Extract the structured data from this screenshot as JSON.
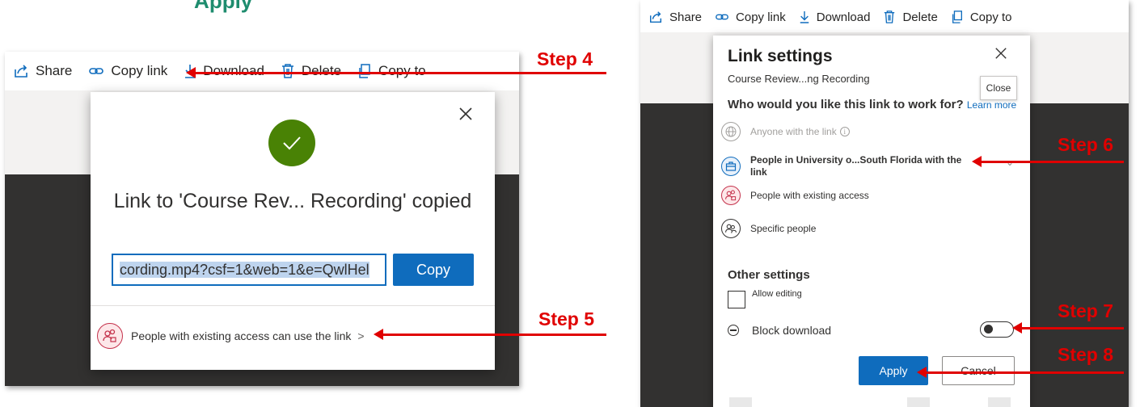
{
  "top_fragment": "’ Apply",
  "left": {
    "toolbar": {
      "share": "Share",
      "copy_link": "Copy link",
      "download": "Download",
      "delete": "Delete",
      "copy_to": "Copy to"
    },
    "dialog": {
      "title": "Link to 'Course Rev... Recording' copied",
      "link_value": "cording.mp4?csf=1&web=1&e=QwlHel",
      "copy_button": "Copy",
      "access_text": "People with existing access can use the link",
      "access_chevron": ">"
    }
  },
  "right": {
    "toolbar": {
      "share": "Share",
      "copy_link": "Copy link",
      "download": "Download",
      "delete": "Delete",
      "copy_to": "Copy to"
    },
    "panel": {
      "title": "Link settings",
      "subtitle": "Course Review...ng Recording",
      "close_tooltip": "Close",
      "question": "Who would you like this link to work for?",
      "learn_more": "Learn more",
      "options": {
        "anyone": "Anyone with the link",
        "org": "People in University o...South Florida with the link",
        "existing": "People with existing access",
        "specific": "Specific people"
      },
      "other_settings": "Other settings",
      "allow_editing": "Allow editing",
      "allow_editing_checked": false,
      "block_download": "Block download",
      "block_download_on": false,
      "apply_button": "Apply",
      "cancel_button": "Cancel"
    }
  },
  "steps": {
    "step4": "Step 4",
    "step5": "Step 5",
    "step6": "Step 6",
    "step7": "Step 7",
    "step8": "Step 8"
  },
  "colors": {
    "accent_blue": "#0f6cbd",
    "success_green": "#498205",
    "annotation_red": "#e00000",
    "dark_background": "#323130"
  }
}
